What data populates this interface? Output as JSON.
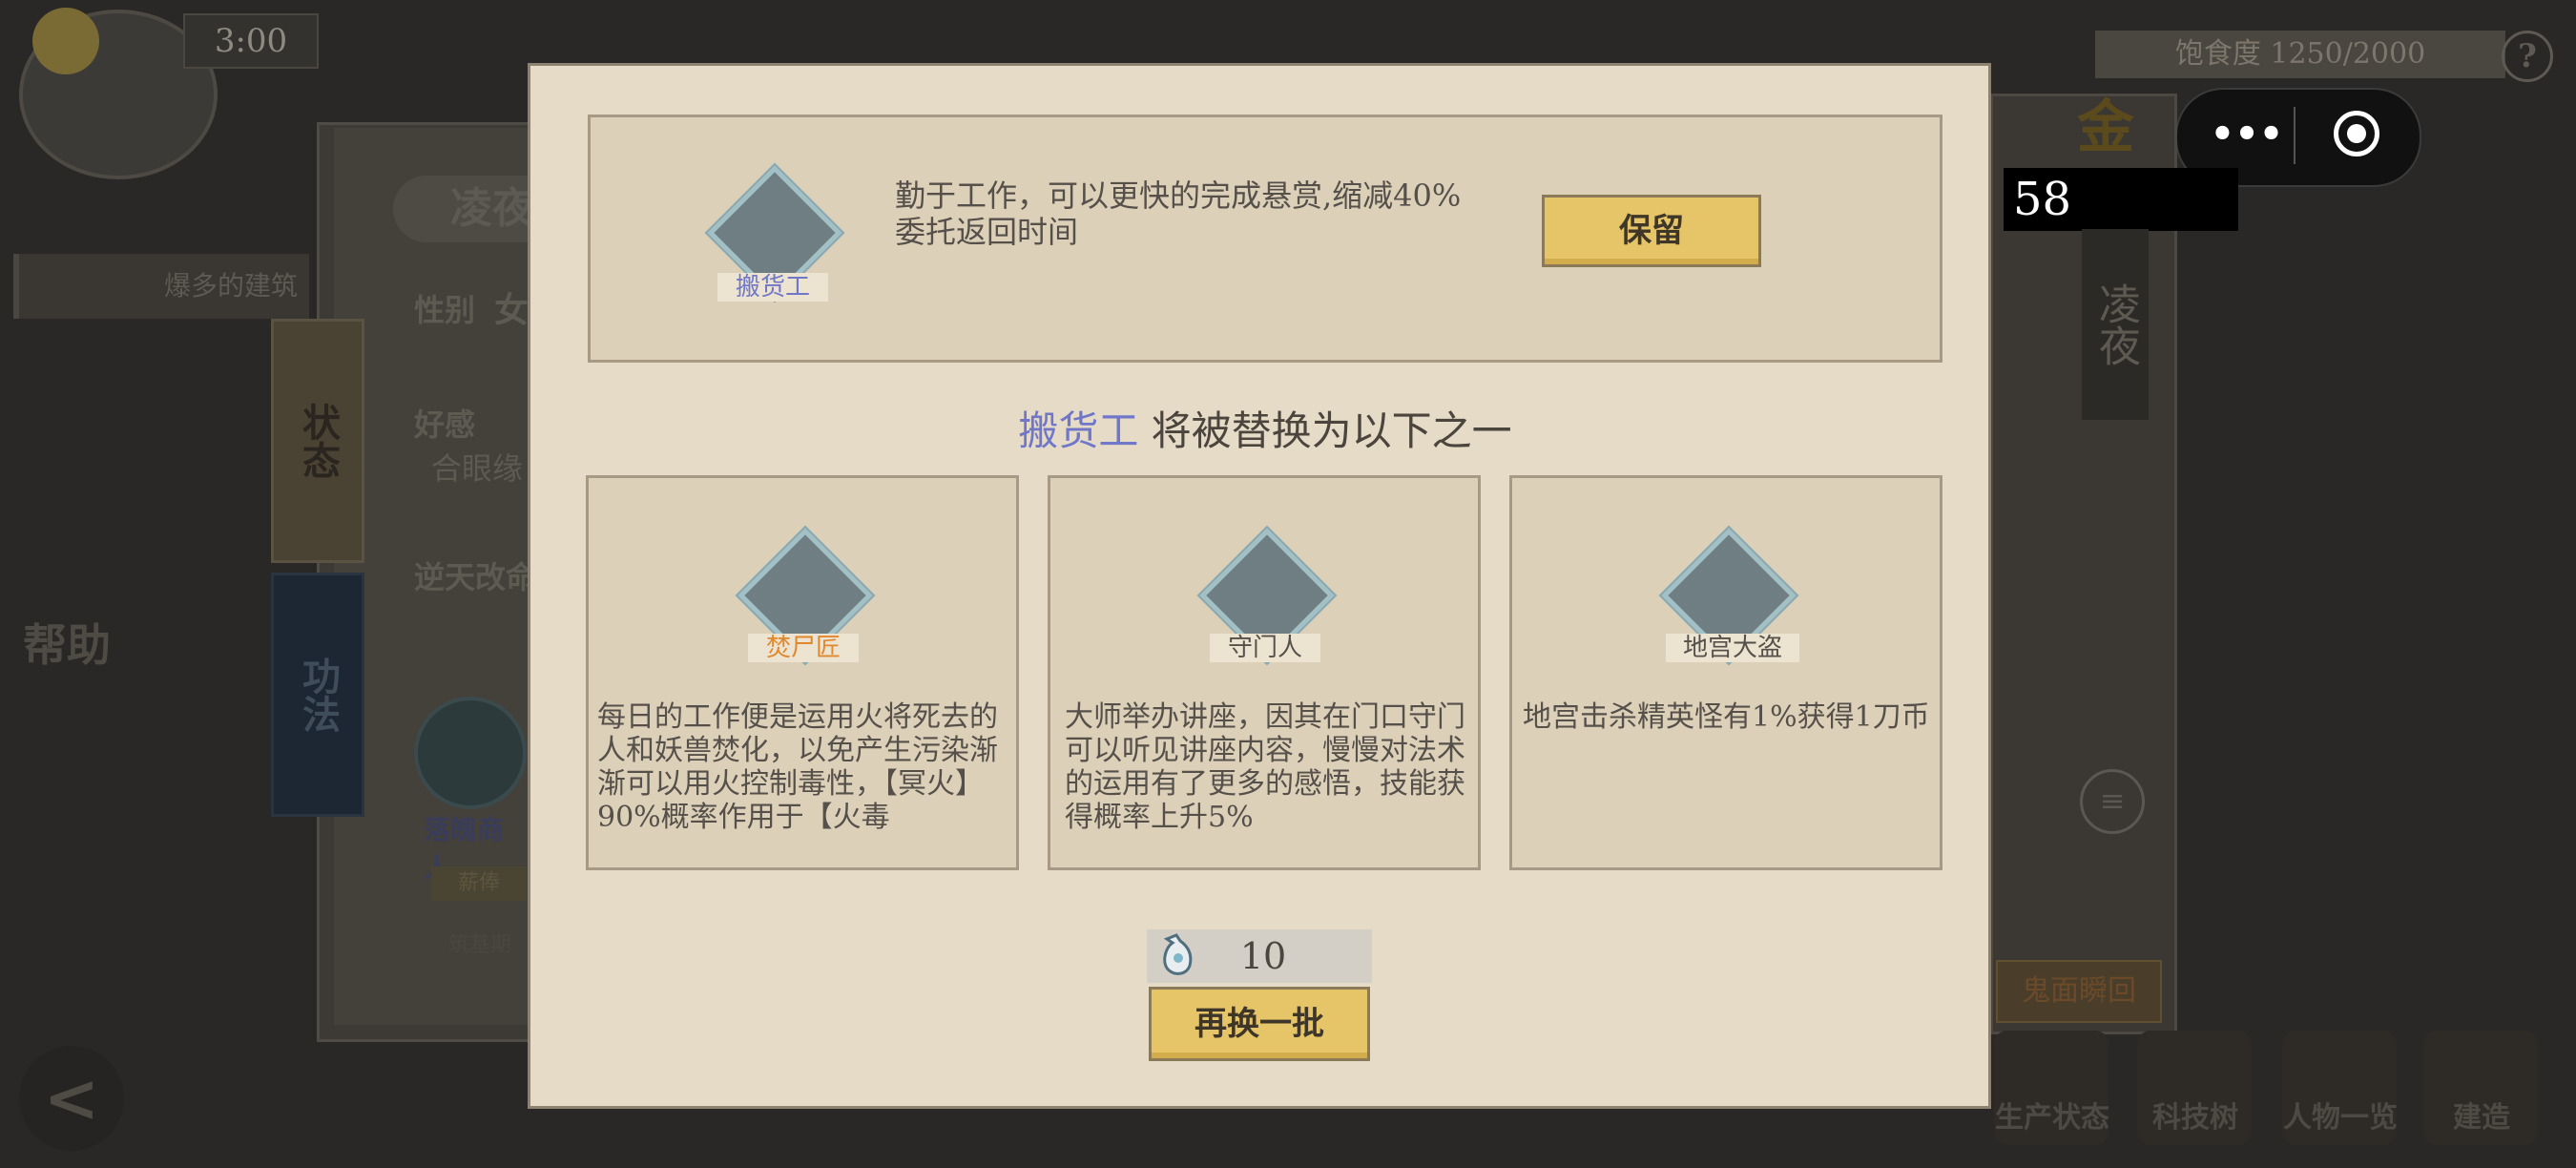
{
  "hud": {
    "time": "3:00",
    "satiety": "饱食度 1250/2000",
    "help_mark": "?",
    "counter": "58",
    "gold_char": "金",
    "help_label": "帮助",
    "back_glyph": "<"
  },
  "capsule": {
    "more": "•••"
  },
  "character_panel": {
    "name_vertical": "凌夜",
    "title": "凌夜",
    "building_strip": "爆多的建筑",
    "gender_label": "性别",
    "gender_value": "女",
    "favor_label": "好感",
    "favor_value": "合眼缘",
    "fate_label": "逆天改命",
    "tab_state": "状态",
    "tab_gongfa": "功法",
    "portrait_name": "落魄商人",
    "portrait_tag": "薪俸",
    "portrait_sub": "筑基期"
  },
  "right_panel": {
    "ghost_button": "鬼面瞬回",
    "menu_glyph": "≡"
  },
  "bottom_nav": [
    {
      "label": "生产状态"
    },
    {
      "label": "科技树"
    },
    {
      "label": "人物一览"
    },
    {
      "label": "建造"
    }
  ],
  "modal": {
    "current": {
      "skill_name": "搬货工",
      "description": "勤于工作，可以更快的完成悬赏,缩减40%委托返回时间",
      "keep_label": "保留"
    },
    "headline_skill": "搬货工",
    "headline_rest": " 将被替换为以下之一",
    "options": [
      {
        "name": "焚尸匠",
        "name_color": "#e0882e",
        "description": "每日的工作便是运用火将死去的人和妖兽焚化，以免产生污染渐渐可以用火控制毒性，【冥火】90%概率作用于【火毒"
      },
      {
        "name": "守门人",
        "name_color": "#55504a",
        "description": "大师举办讲座，因其在门口守门可以听见讲座内容，慢慢对法术的运用有了更多的感悟，技能获得概率上升5%"
      },
      {
        "name": "地宫大盗",
        "name_color": "#55504a",
        "description": "地宫击杀精英怪有1%获得1刀币"
      }
    ],
    "cost": {
      "icon": "spirit-pouch-icon",
      "amount": "10"
    },
    "refresh_label": "再换一批",
    "colors": {
      "current_name": "#7177c8",
      "accent_button": "#e6c468"
    }
  }
}
